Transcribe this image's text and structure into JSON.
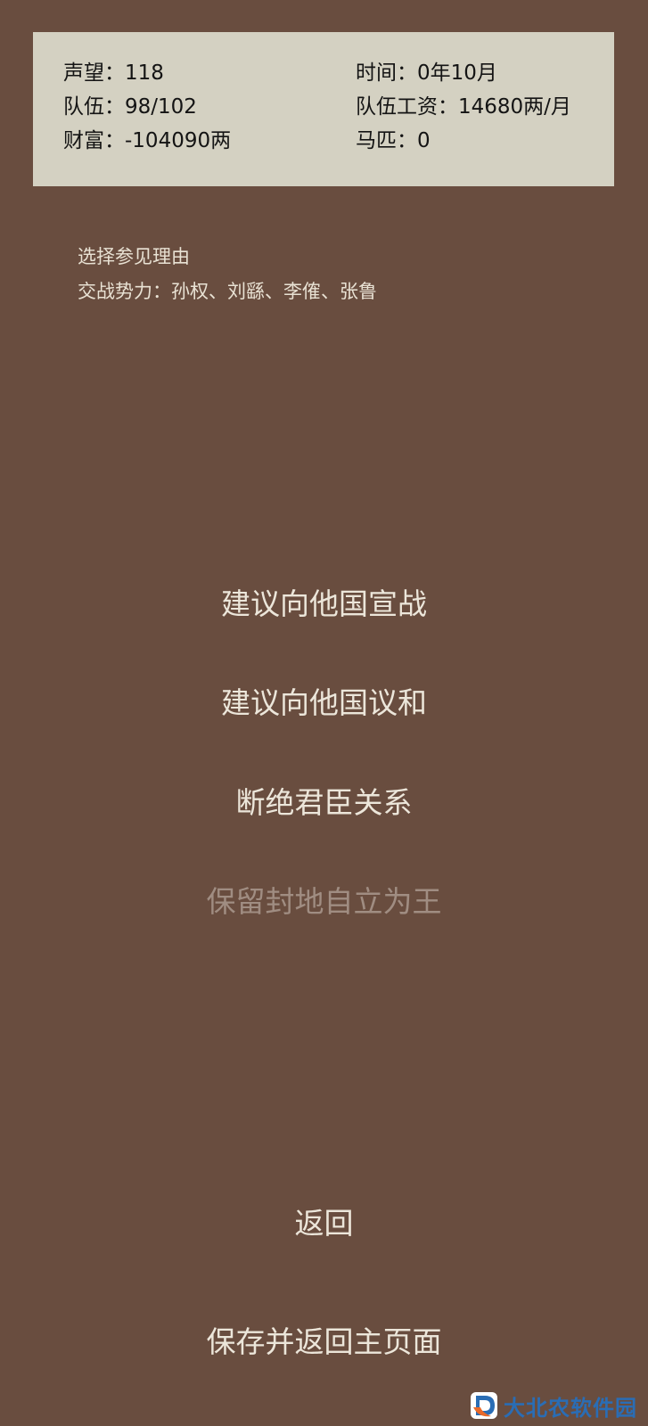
{
  "stats": {
    "reputation": "声望：118",
    "time": "时间：0年10月",
    "troops": "队伍：98/102",
    "wage": "队伍工资：14680两/月",
    "wealth": "财富：-104090两",
    "horses": "马匹：0"
  },
  "info": {
    "title": "选择参见理由",
    "warring": "交战势力：孙权、刘繇、李傕、张鲁"
  },
  "options": [
    {
      "label": "建议向他国宣战",
      "enabled": true
    },
    {
      "label": "建议向他国议和",
      "enabled": true
    },
    {
      "label": "断绝君臣关系",
      "enabled": true
    },
    {
      "label": "保留封地自立为王",
      "enabled": false
    }
  ],
  "nav": {
    "back": "返回",
    "save_return": "保存并返回主页面"
  },
  "watermark": {
    "text": "大北农软件园",
    "icon": "brand-logo-icon",
    "colors": {
      "blue": "#2a6db5",
      "orange": "#e8692a"
    }
  },
  "colors": {
    "background": "#694d3f",
    "panel": "#d4d1c2",
    "text_light": "#ece6da",
    "text_disabled": "#a08d82"
  }
}
